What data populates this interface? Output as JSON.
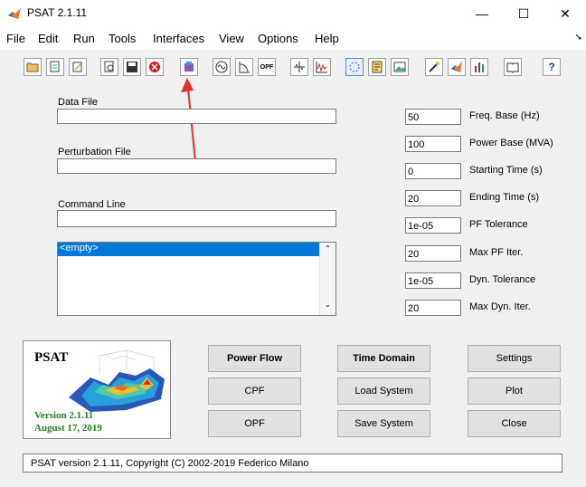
{
  "window": {
    "title": "PSAT 2.1.11",
    "minimize": "—",
    "maximize": "☐",
    "close": "✕"
  },
  "menu": [
    "File",
    "Edit",
    "Run",
    "Tools",
    "Interfaces",
    "View",
    "Options",
    "Help"
  ],
  "fields": {
    "data_file": {
      "label": "Data File",
      "value": ""
    },
    "perturbation_file": {
      "label": "Perturbation File",
      "value": ""
    },
    "command_line": {
      "label": "Command Line",
      "value": ""
    }
  },
  "listbox": {
    "selected": "<empty>"
  },
  "params": [
    {
      "value": "50",
      "label": "Freq. Base (Hz)"
    },
    {
      "value": "100",
      "label": "Power Base (MVA)"
    },
    {
      "value": "0",
      "label": "Starting Time (s)"
    },
    {
      "value": "20",
      "label": "Ending Time (s)"
    },
    {
      "value": "1e-05",
      "label": "PF Tolerance"
    },
    {
      "value": "20",
      "label": "Max PF Iter."
    },
    {
      "value": "1e-05",
      "label": "Dyn. Tolerance"
    },
    {
      "value": "20",
      "label": "Max Dyn. Iter."
    }
  ],
  "logo": {
    "title": "PSAT",
    "version": "Version 2.1.11",
    "date": "August 17, 2019"
  },
  "buttons": {
    "power_flow": "Power Flow",
    "cpf": "CPF",
    "opf": "OPF",
    "time_domain": "Time Domain",
    "load_system": "Load System",
    "save_system": "Save System",
    "settings": "Settings",
    "plot": "Plot",
    "close": "Close"
  },
  "status": "PSAT version 2.1.11, Copyright (C) 2002-2019 Federico Milano",
  "annotation_color": "#e03030"
}
